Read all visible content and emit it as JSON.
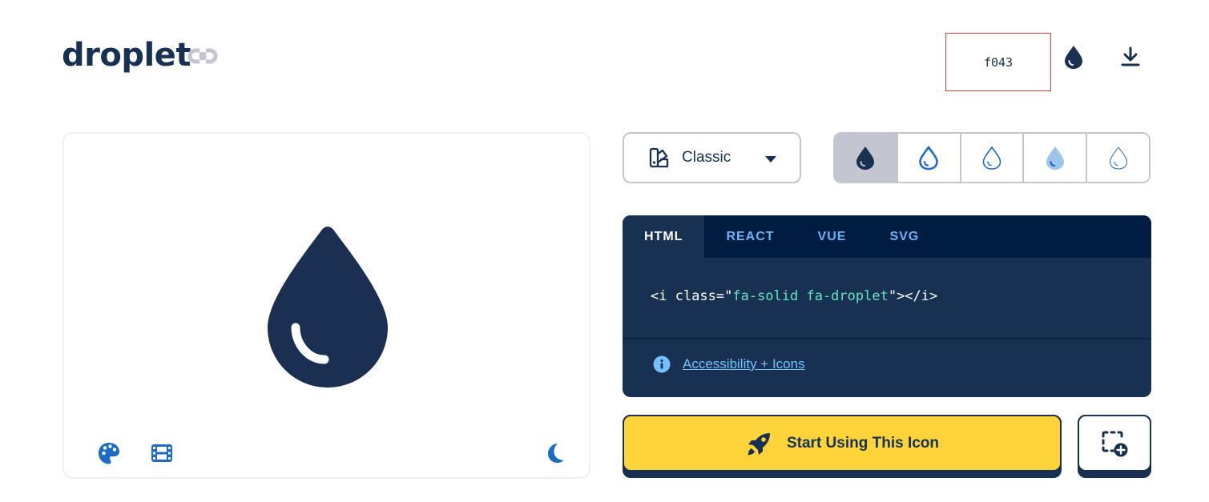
{
  "header": {
    "icon_name": "droplet",
    "unicode": "f043",
    "link_icon": "link-icon",
    "droplet_icon": "droplet-icon",
    "download_icon": "download-icon"
  },
  "preview": {
    "icon": "droplet-icon",
    "controls": [
      "palette-icon",
      "film-icon",
      "moon-icon"
    ]
  },
  "style_select": {
    "label": "Classic",
    "icon": "swatchbook-icon"
  },
  "variants": [
    {
      "name": "solid",
      "active": true
    },
    {
      "name": "regular",
      "active": false
    },
    {
      "name": "light",
      "active": false
    },
    {
      "name": "duotone",
      "active": false
    },
    {
      "name": "thin",
      "active": false
    }
  ],
  "code": {
    "tabs": [
      "HTML",
      "REACT",
      "VUE",
      "SVG"
    ],
    "active_tab": "HTML",
    "snippet_open": "<i class=\"",
    "snippet_class": "fa-solid fa-droplet",
    "snippet_close": "\"></i>",
    "accessibility_link": "Accessibility + Icons"
  },
  "actions": {
    "start_label": "Start Using This Icon",
    "add_icon": "square-dashed-circle-plus-icon"
  },
  "colors": {
    "navy": "#183153",
    "dark_navy": "#001c40",
    "blue": "#1c6bc4",
    "yellow": "#ffd43b",
    "gray": "#c3c6d1",
    "code_string": "#63e6be",
    "link": "#74c0fc"
  }
}
